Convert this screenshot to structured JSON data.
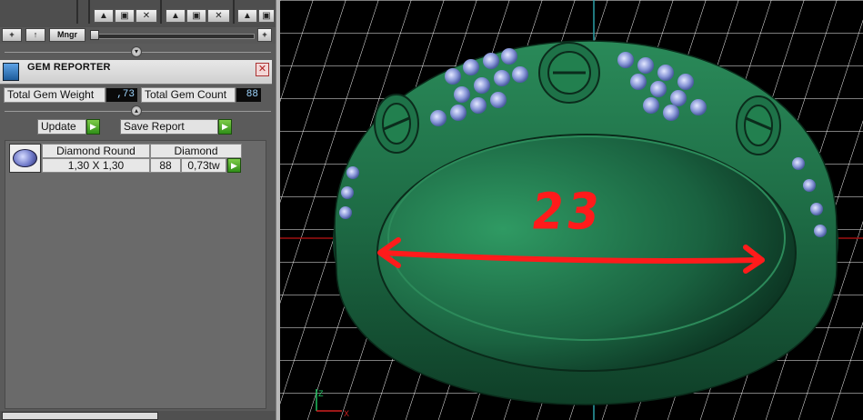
{
  "toolbar": {
    "add_label": "+",
    "up_label": "↑",
    "manager_label": "Mngr",
    "plus_label": "+"
  },
  "panel": {
    "title": "GEM REPORTER",
    "close_glyph": "✕",
    "total_weight_label": "Total Gem Weight",
    "total_weight_value": ",73",
    "total_count_label": "Total Gem Count",
    "total_count_value": "88",
    "update_label": "Update",
    "save_report_label": "Save Report",
    "arrow_glyph": "▶"
  },
  "gem_table": {
    "header": [
      "Diamond Round",
      "Diamond"
    ],
    "rows": [
      {
        "size": "1,30 X 1,30",
        "count": "88",
        "weight": "0,73tw"
      }
    ]
  },
  "viewport": {
    "annotation": "23",
    "axis_z": "Z",
    "axis_x": "X"
  },
  "colors": {
    "ring": "#1f6b45",
    "annotation": "#ff1b1b",
    "grid": "#ffffff"
  }
}
